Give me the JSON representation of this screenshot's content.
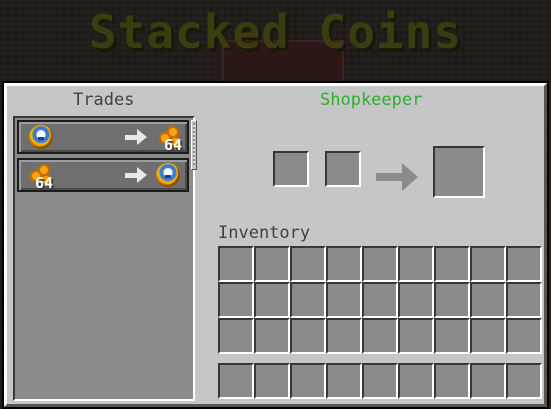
{
  "banner": {
    "title": "Stacked Coins"
  },
  "panel": {
    "trades_label": "Trades",
    "shop_label": "Shopkeeper",
    "inventory_label": "Inventory"
  },
  "trades": [
    {
      "input_icon": "blue-gold-coin-icon",
      "input_count": "",
      "output_icon": "gold-coin-pile-icon",
      "output_count": "64"
    },
    {
      "input_icon": "gold-coin-pile-icon",
      "input_count": "64",
      "output_icon": "blue-gold-coin-icon",
      "output_count": ""
    }
  ],
  "trade_slots": {
    "input_1": "",
    "input_2": "",
    "result": ""
  },
  "inventory": {
    "main_rows": 3,
    "hotbar_rows": 1,
    "columns": 9
  },
  "colors": {
    "shop_label": "#2bb02b",
    "banner": "#3b3d11",
    "panel": "#c6c6c6",
    "slot": "#8b8b8b"
  }
}
